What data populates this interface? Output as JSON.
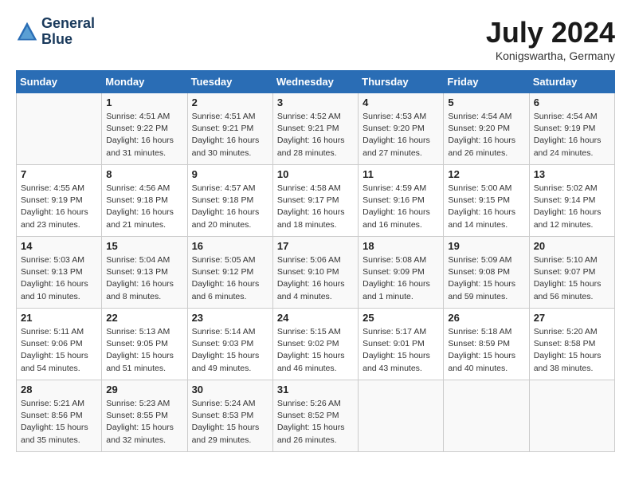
{
  "header": {
    "logo_line1": "General",
    "logo_line2": "Blue",
    "month_year": "July 2024",
    "location": "Konigswartha, Germany"
  },
  "days_of_week": [
    "Sunday",
    "Monday",
    "Tuesday",
    "Wednesday",
    "Thursday",
    "Friday",
    "Saturday"
  ],
  "weeks": [
    [
      {
        "day": "",
        "sunrise": "",
        "sunset": "",
        "daylight": ""
      },
      {
        "day": "1",
        "sunrise": "Sunrise: 4:51 AM",
        "sunset": "Sunset: 9:22 PM",
        "daylight": "Daylight: 16 hours and 31 minutes."
      },
      {
        "day": "2",
        "sunrise": "Sunrise: 4:51 AM",
        "sunset": "Sunset: 9:21 PM",
        "daylight": "Daylight: 16 hours and 30 minutes."
      },
      {
        "day": "3",
        "sunrise": "Sunrise: 4:52 AM",
        "sunset": "Sunset: 9:21 PM",
        "daylight": "Daylight: 16 hours and 28 minutes."
      },
      {
        "day": "4",
        "sunrise": "Sunrise: 4:53 AM",
        "sunset": "Sunset: 9:20 PM",
        "daylight": "Daylight: 16 hours and 27 minutes."
      },
      {
        "day": "5",
        "sunrise": "Sunrise: 4:54 AM",
        "sunset": "Sunset: 9:20 PM",
        "daylight": "Daylight: 16 hours and 26 minutes."
      },
      {
        "day": "6",
        "sunrise": "Sunrise: 4:54 AM",
        "sunset": "Sunset: 9:19 PM",
        "daylight": "Daylight: 16 hours and 24 minutes."
      }
    ],
    [
      {
        "day": "7",
        "sunrise": "Sunrise: 4:55 AM",
        "sunset": "Sunset: 9:19 PM",
        "daylight": "Daylight: 16 hours and 23 minutes."
      },
      {
        "day": "8",
        "sunrise": "Sunrise: 4:56 AM",
        "sunset": "Sunset: 9:18 PM",
        "daylight": "Daylight: 16 hours and 21 minutes."
      },
      {
        "day": "9",
        "sunrise": "Sunrise: 4:57 AM",
        "sunset": "Sunset: 9:18 PM",
        "daylight": "Daylight: 16 hours and 20 minutes."
      },
      {
        "day": "10",
        "sunrise": "Sunrise: 4:58 AM",
        "sunset": "Sunset: 9:17 PM",
        "daylight": "Daylight: 16 hours and 18 minutes."
      },
      {
        "day": "11",
        "sunrise": "Sunrise: 4:59 AM",
        "sunset": "Sunset: 9:16 PM",
        "daylight": "Daylight: 16 hours and 16 minutes."
      },
      {
        "day": "12",
        "sunrise": "Sunrise: 5:00 AM",
        "sunset": "Sunset: 9:15 PM",
        "daylight": "Daylight: 16 hours and 14 minutes."
      },
      {
        "day": "13",
        "sunrise": "Sunrise: 5:02 AM",
        "sunset": "Sunset: 9:14 PM",
        "daylight": "Daylight: 16 hours and 12 minutes."
      }
    ],
    [
      {
        "day": "14",
        "sunrise": "Sunrise: 5:03 AM",
        "sunset": "Sunset: 9:13 PM",
        "daylight": "Daylight: 16 hours and 10 minutes."
      },
      {
        "day": "15",
        "sunrise": "Sunrise: 5:04 AM",
        "sunset": "Sunset: 9:13 PM",
        "daylight": "Daylight: 16 hours and 8 minutes."
      },
      {
        "day": "16",
        "sunrise": "Sunrise: 5:05 AM",
        "sunset": "Sunset: 9:12 PM",
        "daylight": "Daylight: 16 hours and 6 minutes."
      },
      {
        "day": "17",
        "sunrise": "Sunrise: 5:06 AM",
        "sunset": "Sunset: 9:10 PM",
        "daylight": "Daylight: 16 hours and 4 minutes."
      },
      {
        "day": "18",
        "sunrise": "Sunrise: 5:08 AM",
        "sunset": "Sunset: 9:09 PM",
        "daylight": "Daylight: 16 hours and 1 minute."
      },
      {
        "day": "19",
        "sunrise": "Sunrise: 5:09 AM",
        "sunset": "Sunset: 9:08 PM",
        "daylight": "Daylight: 15 hours and 59 minutes."
      },
      {
        "day": "20",
        "sunrise": "Sunrise: 5:10 AM",
        "sunset": "Sunset: 9:07 PM",
        "daylight": "Daylight: 15 hours and 56 minutes."
      }
    ],
    [
      {
        "day": "21",
        "sunrise": "Sunrise: 5:11 AM",
        "sunset": "Sunset: 9:06 PM",
        "daylight": "Daylight: 15 hours and 54 minutes."
      },
      {
        "day": "22",
        "sunrise": "Sunrise: 5:13 AM",
        "sunset": "Sunset: 9:05 PM",
        "daylight": "Daylight: 15 hours and 51 minutes."
      },
      {
        "day": "23",
        "sunrise": "Sunrise: 5:14 AM",
        "sunset": "Sunset: 9:03 PM",
        "daylight": "Daylight: 15 hours and 49 minutes."
      },
      {
        "day": "24",
        "sunrise": "Sunrise: 5:15 AM",
        "sunset": "Sunset: 9:02 PM",
        "daylight": "Daylight: 15 hours and 46 minutes."
      },
      {
        "day": "25",
        "sunrise": "Sunrise: 5:17 AM",
        "sunset": "Sunset: 9:01 PM",
        "daylight": "Daylight: 15 hours and 43 minutes."
      },
      {
        "day": "26",
        "sunrise": "Sunrise: 5:18 AM",
        "sunset": "Sunset: 8:59 PM",
        "daylight": "Daylight: 15 hours and 40 minutes."
      },
      {
        "day": "27",
        "sunrise": "Sunrise: 5:20 AM",
        "sunset": "Sunset: 8:58 PM",
        "daylight": "Daylight: 15 hours and 38 minutes."
      }
    ],
    [
      {
        "day": "28",
        "sunrise": "Sunrise: 5:21 AM",
        "sunset": "Sunset: 8:56 PM",
        "daylight": "Daylight: 15 hours and 35 minutes."
      },
      {
        "day": "29",
        "sunrise": "Sunrise: 5:23 AM",
        "sunset": "Sunset: 8:55 PM",
        "daylight": "Daylight: 15 hours and 32 minutes."
      },
      {
        "day": "30",
        "sunrise": "Sunrise: 5:24 AM",
        "sunset": "Sunset: 8:53 PM",
        "daylight": "Daylight: 15 hours and 29 minutes."
      },
      {
        "day": "31",
        "sunrise": "Sunrise: 5:26 AM",
        "sunset": "Sunset: 8:52 PM",
        "daylight": "Daylight: 15 hours and 26 minutes."
      },
      {
        "day": "",
        "sunrise": "",
        "sunset": "",
        "daylight": ""
      },
      {
        "day": "",
        "sunrise": "",
        "sunset": "",
        "daylight": ""
      },
      {
        "day": "",
        "sunrise": "",
        "sunset": "",
        "daylight": ""
      }
    ]
  ]
}
